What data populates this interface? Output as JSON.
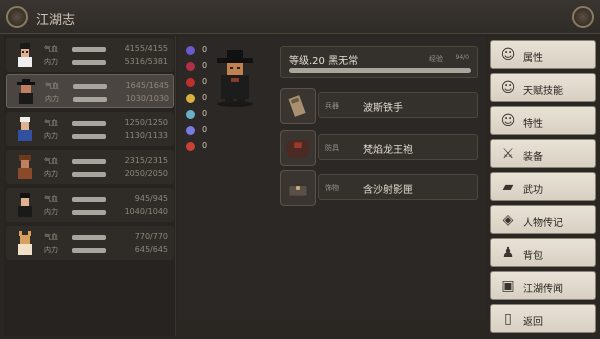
{
  "header": {
    "title": "江湖志"
  },
  "party": [
    {
      "hp_label": "气血",
      "mp_label": "内力",
      "hp": "4155/4155",
      "mp": "5316/5381",
      "hp_frac": 1.0,
      "mp_frac": 0.99
    },
    {
      "hp_label": "气血",
      "mp_label": "内力",
      "hp": "1645/1645",
      "mp": "1030/1030",
      "hp_frac": 1.0,
      "mp_frac": 1.0
    },
    {
      "hp_label": "气血",
      "mp_label": "内力",
      "hp": "1250/1250",
      "mp": "1130/1133",
      "hp_frac": 1.0,
      "mp_frac": 1.0
    },
    {
      "hp_label": "气血",
      "mp_label": "内力",
      "hp": "2315/2315",
      "mp": "2050/2050",
      "hp_frac": 1.0,
      "mp_frac": 1.0
    },
    {
      "hp_label": "气血",
      "mp_label": "内力",
      "hp": "945/945",
      "mp": "1040/1040",
      "hp_frac": 1.0,
      "mp_frac": 1.0
    },
    {
      "hp_label": "气血",
      "mp_label": "内力",
      "hp": "770/770",
      "mp": "645/645",
      "hp_frac": 1.0,
      "mp_frac": 1.0
    }
  ],
  "stats": [
    {
      "icon": "purple-orb-icon",
      "color": "#6a5acd",
      "value": "0"
    },
    {
      "icon": "broken-heart-icon",
      "color": "#b0304a",
      "value": "0"
    },
    {
      "icon": "red-gem-icon",
      "color": "#c0302a",
      "value": "0"
    },
    {
      "icon": "sword-icon",
      "color": "#d8b040",
      "value": "0"
    },
    {
      "icon": "blue-orb-icon",
      "color": "#6ab0c8",
      "value": "0"
    },
    {
      "icon": "shield-orb-icon",
      "color": "#7a7ae0",
      "value": "0"
    },
    {
      "icon": "flame-icon",
      "color": "#c84038",
      "value": "0"
    }
  ],
  "hero": {
    "level_text": "等级.20  黑无常",
    "exp_label": "经验",
    "exp_value": "94/0",
    "exp_frac": 1.0
  },
  "equipment": [
    {
      "type": "兵器",
      "name": "波斯铁手"
    },
    {
      "type": "防具",
      "name": "梵焰龙王袍"
    },
    {
      "type": "饰物",
      "name": "含沙射影匣"
    }
  ],
  "menu": [
    {
      "label": "属性",
      "icon": "attributes-icon",
      "glyph": "☺"
    },
    {
      "label": "天赋技能",
      "icon": "talent-icon",
      "glyph": "☺"
    },
    {
      "label": "特性",
      "icon": "trait-icon",
      "glyph": "☺"
    },
    {
      "label": "装备",
      "icon": "sword-icon",
      "glyph": "⚔"
    },
    {
      "label": "武功",
      "icon": "book-icon",
      "glyph": "▰"
    },
    {
      "label": "人物传记",
      "icon": "scroll-icon",
      "glyph": "◈"
    },
    {
      "label": "背包",
      "icon": "bag-icon",
      "glyph": "♟"
    },
    {
      "label": "江湖传闻",
      "icon": "notice-icon",
      "glyph": "▣"
    },
    {
      "label": "返回",
      "icon": "exit-door-icon",
      "glyph": "▯"
    }
  ]
}
